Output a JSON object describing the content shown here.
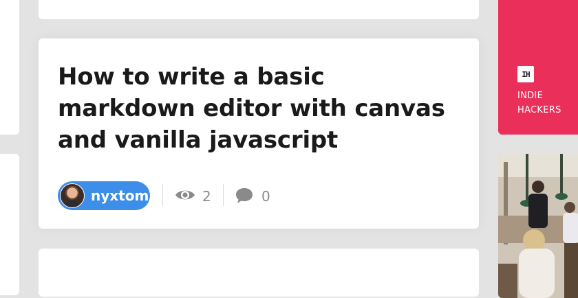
{
  "post": {
    "title": "How to write a basic markdown editor with canvas and vanilla javascript",
    "author": "nyxtom",
    "views": "2",
    "comments": "0"
  },
  "sidebar_ad": {
    "logo_text": "IH",
    "brand": "INDIE HACKERS",
    "brand_lines": [
      "INDIE",
      "HACKERS"
    ],
    "color": "#ea2f5b"
  },
  "icons": {
    "views": "eye-icon",
    "comments": "comment-bubble-icon"
  },
  "colors": {
    "author_chip": "#3c8ee8",
    "background": "#e3e3e3",
    "card": "#ffffff"
  }
}
